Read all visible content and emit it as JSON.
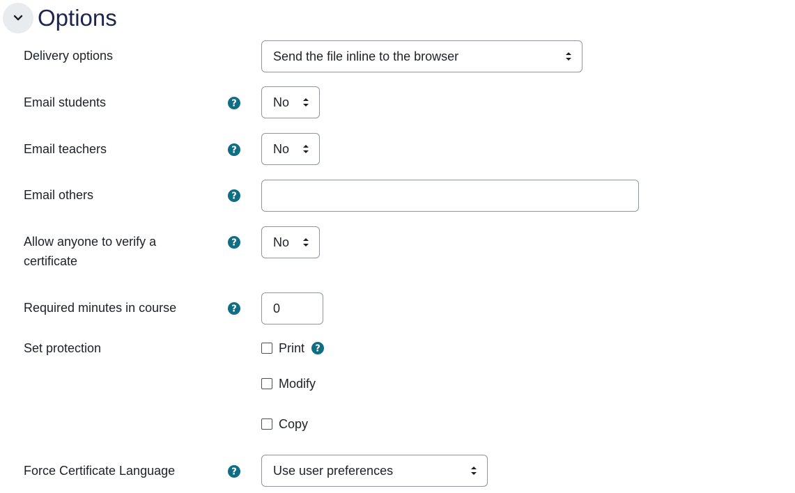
{
  "section": {
    "title": "Options",
    "icon": "chevron-down-icon"
  },
  "fields": {
    "delivery": {
      "label": "Delivery options",
      "value": "Send the file inline to the browser"
    },
    "email_students": {
      "label": "Email students",
      "value": "No"
    },
    "email_teachers": {
      "label": "Email teachers",
      "value": "No"
    },
    "email_others": {
      "label": "Email others",
      "value": ""
    },
    "verify": {
      "label": "Allow anyone to verify a certificate",
      "value": "No"
    },
    "required_minutes": {
      "label": "Required minutes in course",
      "value": "0"
    },
    "protection": {
      "label": "Set protection",
      "options": [
        "Print",
        "Modify",
        "Copy"
      ]
    },
    "language": {
      "label": "Force Certificate Language",
      "value": "Use user preferences"
    }
  },
  "colors": {
    "help_icon": "#0f6e84",
    "title": "#1d2450",
    "border": "#8f959e"
  }
}
